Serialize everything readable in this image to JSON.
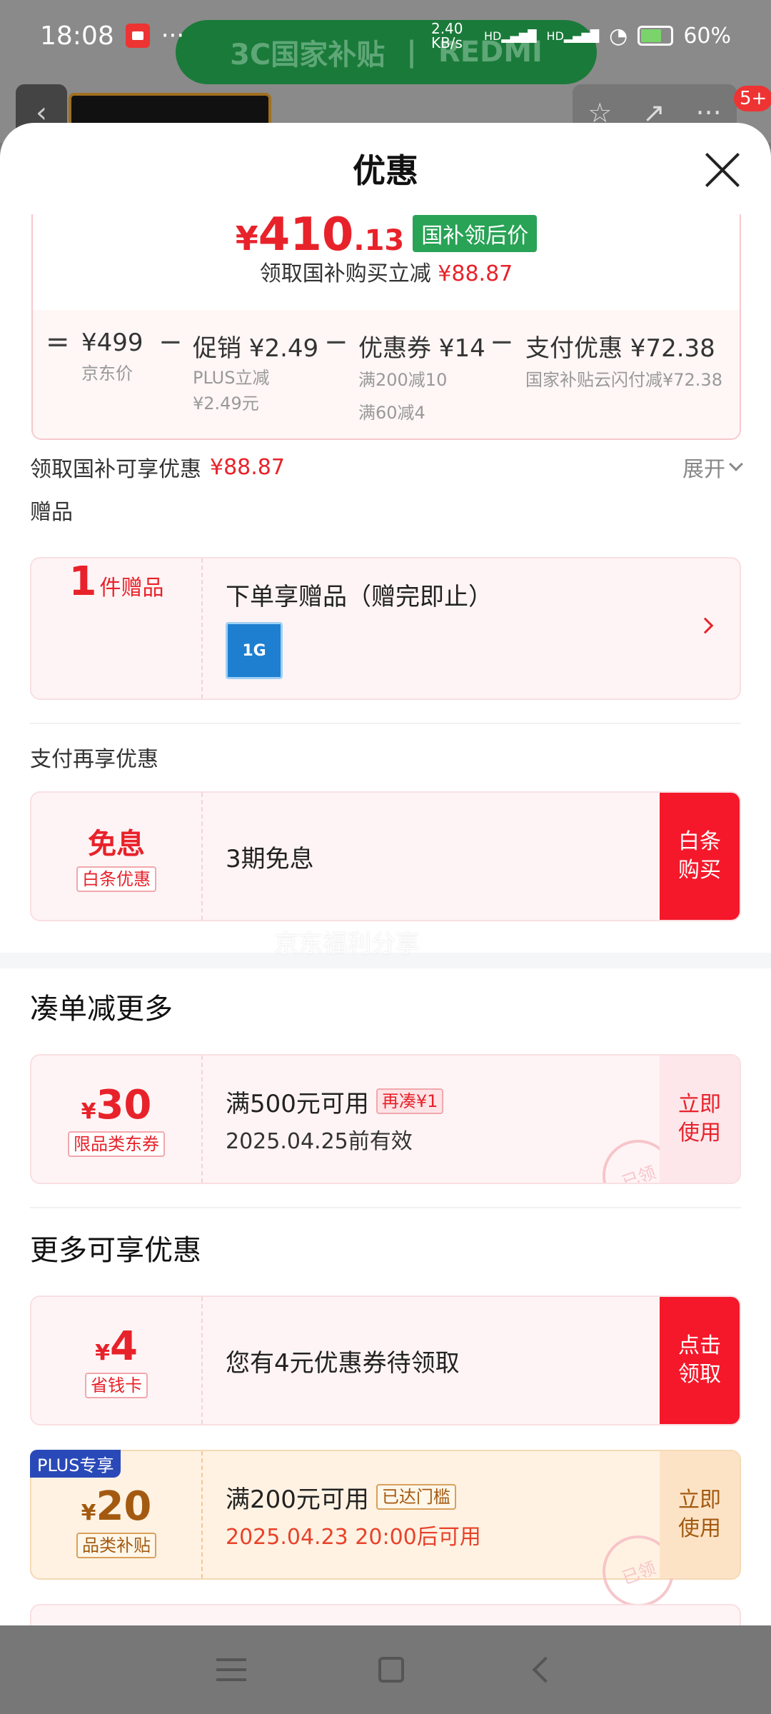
{
  "status_bar": {
    "time": "18:08",
    "dots": "···",
    "network_speed": "2.40 KB/s",
    "signal1": "HD",
    "signal2": "HD",
    "battery": "60%"
  },
  "background": {
    "banner_left": "3C国家补贴",
    "banner_right": "REDMI",
    "badge": "5+"
  },
  "sheet": {
    "title": "优惠"
  },
  "price": {
    "yen": "¥",
    "int": "410",
    "dec": ".13",
    "tag": "国补领后价",
    "sub_text": "领取国补购买立减",
    "sub_amount": "¥88.87",
    "breakdown": {
      "eq": "=",
      "minus": "−",
      "jd_price": "¥499",
      "jd_label": "京东价",
      "promo": "促销 ¥2.49",
      "promo_note1": "PLUS立减",
      "promo_note2": "¥2.49元",
      "coupon": "优惠券 ¥14",
      "coupon_note1": "满200减10",
      "coupon_note2": "满60减4",
      "pay": "支付优惠 ¥72.38",
      "pay_note": "国家补贴云闪付减¥72.38"
    }
  },
  "subsidy_row": {
    "label": "领取国补可享优惠",
    "amount": "¥88.87",
    "expand": "展开"
  },
  "gift": {
    "section_label": "赠品",
    "count": "1",
    "count_unit": "件赠品",
    "title": "下单享赠品（赠完即止）",
    "thumb_text": "1G"
  },
  "pay_more": {
    "section_label": "支付再享优惠",
    "left_title": "免息",
    "left_tag": "白条优惠",
    "text": "3期免息",
    "btn_line1": "白条",
    "btn_line2": "购买",
    "watermark": "京东福利分享"
  },
  "combine": {
    "section_title": "凑单减更多",
    "coupon": {
      "yen": "¥",
      "amount": "30",
      "tag": "限品类东券",
      "condition": "满500元可用",
      "hint": "再凑¥1",
      "expiry": "2025.04.25前有效",
      "btn_line1": "立即",
      "btn_line2": "使用",
      "stamp": "已领"
    }
  },
  "more": {
    "section_title": "更多可享优惠",
    "saving_card": {
      "yen": "¥",
      "amount": "4",
      "tag": "省钱卡",
      "text": "您有4元优惠券待领取",
      "btn_line1": "点击",
      "btn_line2": "领取"
    },
    "plus_coupon": {
      "corner": "PLUS专享",
      "yen": "¥",
      "amount": "20",
      "tag": "品类补贴",
      "condition": "满200元可用",
      "hint": "已达门槛",
      "time": "2025.04.23 20:00后可用",
      "btn_line1": "立即",
      "btn_line2": "使用",
      "stamp": "已领"
    }
  }
}
